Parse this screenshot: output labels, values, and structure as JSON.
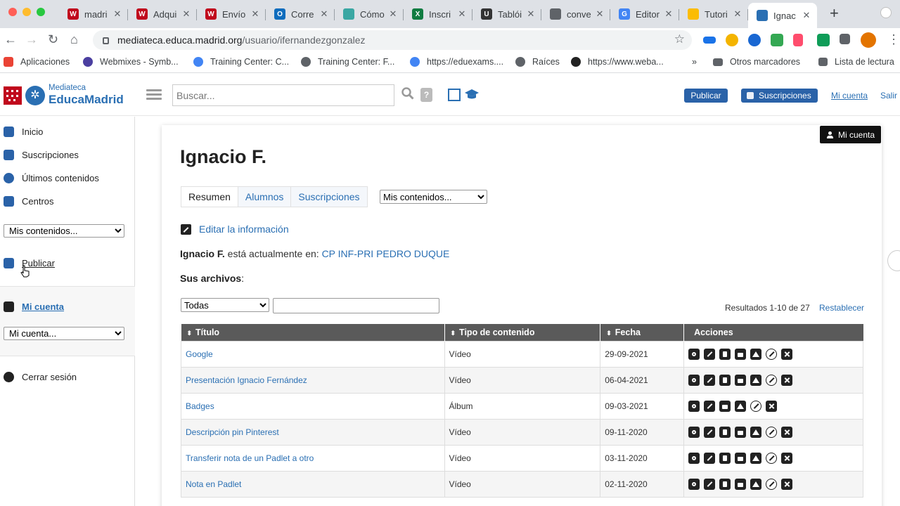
{
  "browser": {
    "tabs": [
      {
        "label": "madri",
        "color": "#c0081c",
        "glyph": "W"
      },
      {
        "label": "Adqui",
        "color": "#c0081c",
        "glyph": "W"
      },
      {
        "label": "Envío",
        "color": "#c0081c",
        "glyph": "W"
      },
      {
        "label": "Corre",
        "color": "#0f6cbd",
        "glyph": "O"
      },
      {
        "label": "Cómo",
        "color": "#3aa7a3",
        "glyph": ""
      },
      {
        "label": "Inscri",
        "color": "#107c41",
        "glyph": "X"
      },
      {
        "label": "Tablói",
        "color": "#333333",
        "glyph": "U"
      },
      {
        "label": "conve",
        "color": "#5f6368",
        "glyph": ""
      },
      {
        "label": "Editor",
        "color": "#4285f4",
        "glyph": "G"
      },
      {
        "label": "Tutori",
        "color": "#fbbc04",
        "glyph": ""
      },
      {
        "label": "Ignac",
        "color": "#2a6fb3",
        "glyph": ""
      }
    ],
    "url_domain": "mediateca.educa.madrid.org",
    "url_path": "/usuario/ifernandezgonzalez",
    "bookmarks": [
      {
        "label": "Aplicaciones",
        "color": "#ea4335"
      },
      {
        "label": "Webmixes - Symb...",
        "color": "#4b3fa0"
      },
      {
        "label": "Training Center: C...",
        "color": "#4285f4"
      },
      {
        "label": "Training Center: F...",
        "color": "#5f6368"
      },
      {
        "label": "https://eduexams....",
        "color": "#4285f4"
      },
      {
        "label": "Raíces",
        "color": "#5f6368"
      },
      {
        "label": "https://www.weba...",
        "color": "#222222"
      }
    ],
    "more": "»",
    "other_bookmarks": "Otros marcadores",
    "reading_list": "Lista de lectura"
  },
  "header": {
    "logo_small": "Mediateca",
    "logo_big": "EducaMadrid",
    "search_placeholder": "Buscar...",
    "publicar": "Publicar",
    "suscripciones": "Suscripciones",
    "mi_cuenta": "Mi cuenta",
    "salir": "Salir"
  },
  "sidebar": {
    "items": [
      {
        "label": "Inicio"
      },
      {
        "label": "Suscripciones"
      },
      {
        "label": "Últimos contenidos"
      },
      {
        "label": "Centros"
      }
    ],
    "select_contenidos": "Mis contenidos...",
    "publicar": "Publicar",
    "mi_cuenta": "Mi cuenta",
    "select_cuenta": "Mi cuenta...",
    "cerrar_sesion": "Cerrar sesión"
  },
  "main": {
    "badge": "Mi cuenta",
    "title": "Ignacio F.",
    "tabs": [
      {
        "label": "Resumen"
      },
      {
        "label": "Alumnos"
      },
      {
        "label": "Suscripciones"
      }
    ],
    "select_contenidos": "Mis contenidos...",
    "edit_info": "Editar la información",
    "where_name": "Ignacio F.",
    "where_text": " está actualmente en: ",
    "where_center": "CP INF-PRI PEDRO DUQUE",
    "archivos_label": "Sus archivos",
    "archivos_colon": ":",
    "filter_select": "Todas",
    "results": "Resultados 1-10 de 27",
    "reset": "Restablecer",
    "columns": [
      "Título",
      "Tipo de contenido",
      "Fecha",
      "Acciones"
    ],
    "rows": [
      {
        "title": "Google",
        "type": "Vídeo",
        "date": "29-09-2021",
        "actions": 7
      },
      {
        "title": "Presentación Ignacio Fernández",
        "type": "Vídeo",
        "date": "06-04-2021",
        "actions": 7
      },
      {
        "title": "Badges",
        "type": "Álbum",
        "date": "09-03-2021",
        "actions": 6
      },
      {
        "title": "Descripción pin Pinterest",
        "type": "Vídeo",
        "date": "09-11-2020",
        "actions": 7
      },
      {
        "title": "Transferir nota de un Padlet a otro",
        "type": "Vídeo",
        "date": "03-11-2020",
        "actions": 7
      },
      {
        "title": "Nota en Padlet",
        "type": "Vídeo",
        "date": "02-11-2020",
        "actions": 7
      }
    ]
  }
}
